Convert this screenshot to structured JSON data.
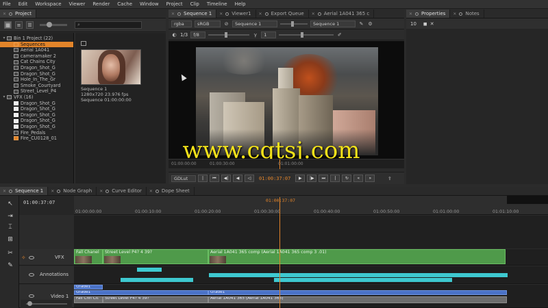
{
  "menubar": [
    "File",
    "Edit",
    "Workspace",
    "Viewer",
    "Render",
    "Cache",
    "Window",
    "Project",
    "Clip",
    "Timeline",
    "Help"
  ],
  "top_left_tabs": [
    {
      "label": "Project",
      "active": true
    }
  ],
  "viewer_tabs": [
    {
      "label": "Sequence 1",
      "active": true
    },
    {
      "label": "Viewer1",
      "active": false
    },
    {
      "label": "Export Queue",
      "active": false
    },
    {
      "label": "Aerial 1A041 365 c",
      "active": false
    }
  ],
  "right_tabs": [
    {
      "label": "Properties",
      "active": true
    },
    {
      "label": "Notes",
      "active": false
    }
  ],
  "timeline_tabs": [
    {
      "label": "Sequence 1",
      "active": true
    },
    {
      "label": "Node Graph",
      "active": false
    },
    {
      "label": "Curve Editor",
      "active": false
    },
    {
      "label": "Dope Sheet",
      "active": false
    }
  ],
  "project": {
    "search_placeholder": "",
    "tree": [
      {
        "label": "Bin 1 Project (22)",
        "indent": 0,
        "icon": "dark",
        "twist": "▾",
        "sel": false
      },
      {
        "label": "Sequences",
        "indent": 1,
        "icon": "orange",
        "twist": "",
        "sel": true
      },
      {
        "label": "Aerial 1A041",
        "indent": 1,
        "icon": "dark",
        "twist": "",
        "sel": false
      },
      {
        "label": "cameramaker 2",
        "indent": 1,
        "icon": "dark",
        "twist": "",
        "sel": false
      },
      {
        "label": "Cat Chains City",
        "indent": 1,
        "icon": "dark",
        "twist": "",
        "sel": false
      },
      {
        "label": "Dragon_Shot_G",
        "indent": 1,
        "icon": "dark",
        "twist": "",
        "sel": false
      },
      {
        "label": "Dragon_Shot_G",
        "indent": 1,
        "icon": "dark",
        "twist": "",
        "sel": false
      },
      {
        "label": "Hole_In_The_Gr",
        "indent": 1,
        "icon": "dark",
        "twist": "",
        "sel": false
      },
      {
        "label": "Smoke_Courtyard",
        "indent": 1,
        "icon": "dark",
        "twist": "",
        "sel": false
      },
      {
        "label": "Street_Level_P4",
        "indent": 1,
        "icon": "dark",
        "twist": "",
        "sel": false
      },
      {
        "label": "VFX (16)",
        "indent": 0,
        "icon": "dark",
        "twist": "▾",
        "sel": false
      },
      {
        "label": "Dragon_Shot_G",
        "indent": 1,
        "icon": "white",
        "twist": "",
        "sel": false
      },
      {
        "label": "Dragon_Shot_G",
        "indent": 1,
        "icon": "white",
        "twist": "",
        "sel": false
      },
      {
        "label": "Dragon_Shot_G",
        "indent": 1,
        "icon": "white",
        "twist": "",
        "sel": false
      },
      {
        "label": "Dragon_Shot_G",
        "indent": 1,
        "icon": "white",
        "twist": "",
        "sel": false
      },
      {
        "label": "Dragon_Shot_G",
        "indent": 1,
        "icon": "white",
        "twist": "",
        "sel": false
      },
      {
        "label": "Fire_Pedals",
        "indent": 1,
        "icon": "dark",
        "twist": "",
        "sel": false
      },
      {
        "label": "Fire_CU0128_01",
        "indent": 1,
        "icon": "orange",
        "twist": "",
        "sel": false
      }
    ],
    "thumb": {
      "name": "Sequence 1",
      "meta": "1280x720 23.976 fps",
      "meta2": "Sequence 01:00:00:00"
    }
  },
  "viewer": {
    "channels": "rgba",
    "colorspace": "sRGB",
    "input": "Sequence 1",
    "input2": "Sequence 1",
    "zoom": "1/3",
    "gain": "f/8",
    "gamma": "1",
    "lut": "GDLut",
    "timecode": "01:00:37:07",
    "ruler_left": "01:00:00:00",
    "ruler_mid": "01:00:30:00",
    "ruler_mid2": "01:01:00:00"
  },
  "properties": {
    "count": "10"
  },
  "timeline": {
    "timecode": "01:00:37:07",
    "playhead_tc": "01:00:37:07",
    "ruler_ticks": [
      "01:00:00:00",
      "01:00:10:00",
      "01:00:20:00",
      "01:00:30:00",
      "01:00:40:00",
      "01:00:50:00",
      "01:01:00:00",
      "01:01:10:00"
    ],
    "tracks": {
      "vfx": "VFX",
      "annotations": "Annotations",
      "video": "Video 1"
    },
    "vfx_clips": [
      "Fall Chanel",
      "Street Level P4? 4 39?",
      "Aerial 1A041 365 comp (Aerial 1A041 365 comp 3 .01)"
    ],
    "video_clips_top": [
      "Grade1",
      "Grade1",
      "Grade1"
    ],
    "video_clips_bottom": [
      "Fall Chn Cit",
      "Street Level P4? 4 39?",
      "Aerial 1A041 365 (Aerial 1A041 365)"
    ]
  },
  "watermark": "www.cgtsj.com"
}
